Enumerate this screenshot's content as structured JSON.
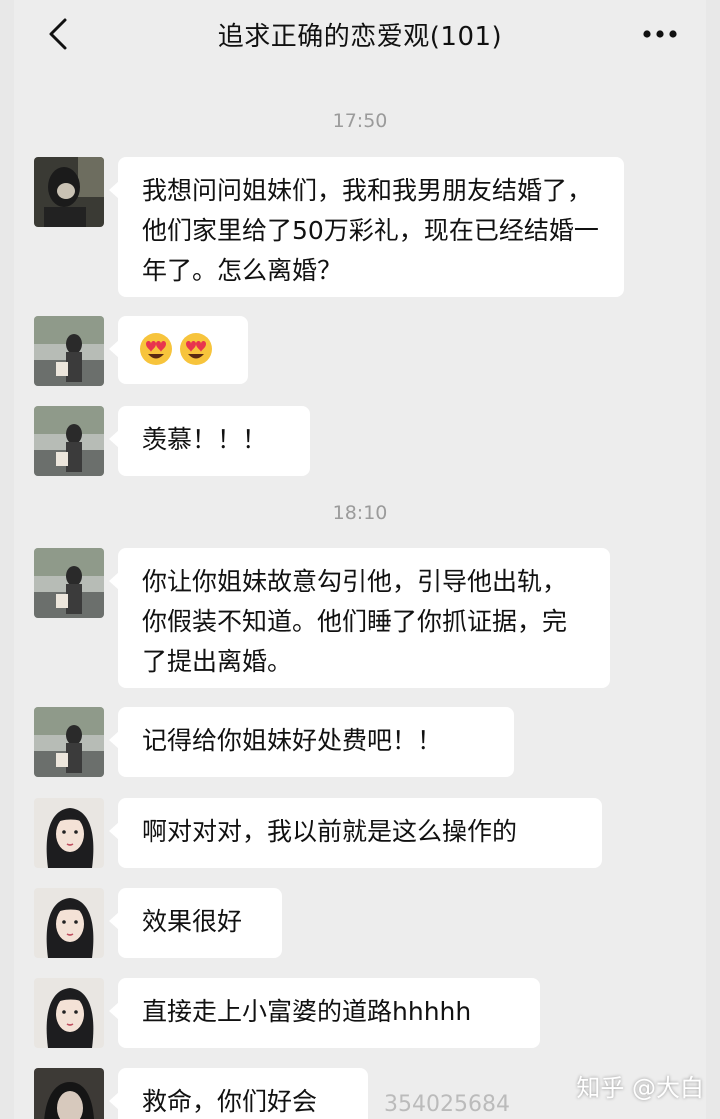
{
  "header": {
    "title": "追求正确的恋爱观(101)",
    "back_icon": "chevron-left-icon",
    "more_icon": "ellipsis-icon"
  },
  "timestamps": [
    "17:50",
    "18:10"
  ],
  "messages": [
    {
      "avatar": "avatar-dark-selfie",
      "text": "我想问问姐妹们，我和我男朋友结婚了，他们家里给了50万彩礼，现在已经结婚一年了。怎么离婚？"
    },
    {
      "avatar": "avatar-street-photo",
      "emoji": [
        "heart-eyes-emoji",
        "heart-eyes-emoji"
      ]
    },
    {
      "avatar": "avatar-street-photo",
      "text": "羡慕！！！"
    },
    {
      "avatar": "avatar-street-photo",
      "text": "你让你姐妹故意勾引他，引导他出轨，你假装不知道。他们睡了你抓证据，完了提出离婚。"
    },
    {
      "avatar": "avatar-street-photo",
      "text": "记得给你姐妹好处费吧！！"
    },
    {
      "avatar": "avatar-anime-girl",
      "text": "啊对对对，我以前就是这么操作的"
    },
    {
      "avatar": "avatar-anime-girl",
      "text": "效果很好"
    },
    {
      "avatar": "avatar-anime-girl",
      "text": "直接走上小富婆的道路hhhhh"
    },
    {
      "avatar": "avatar-dark-portrait",
      "text": "救命，你们好会"
    }
  ],
  "overlay": {
    "faint_number": "354025684",
    "watermark": "知乎 @大白"
  }
}
